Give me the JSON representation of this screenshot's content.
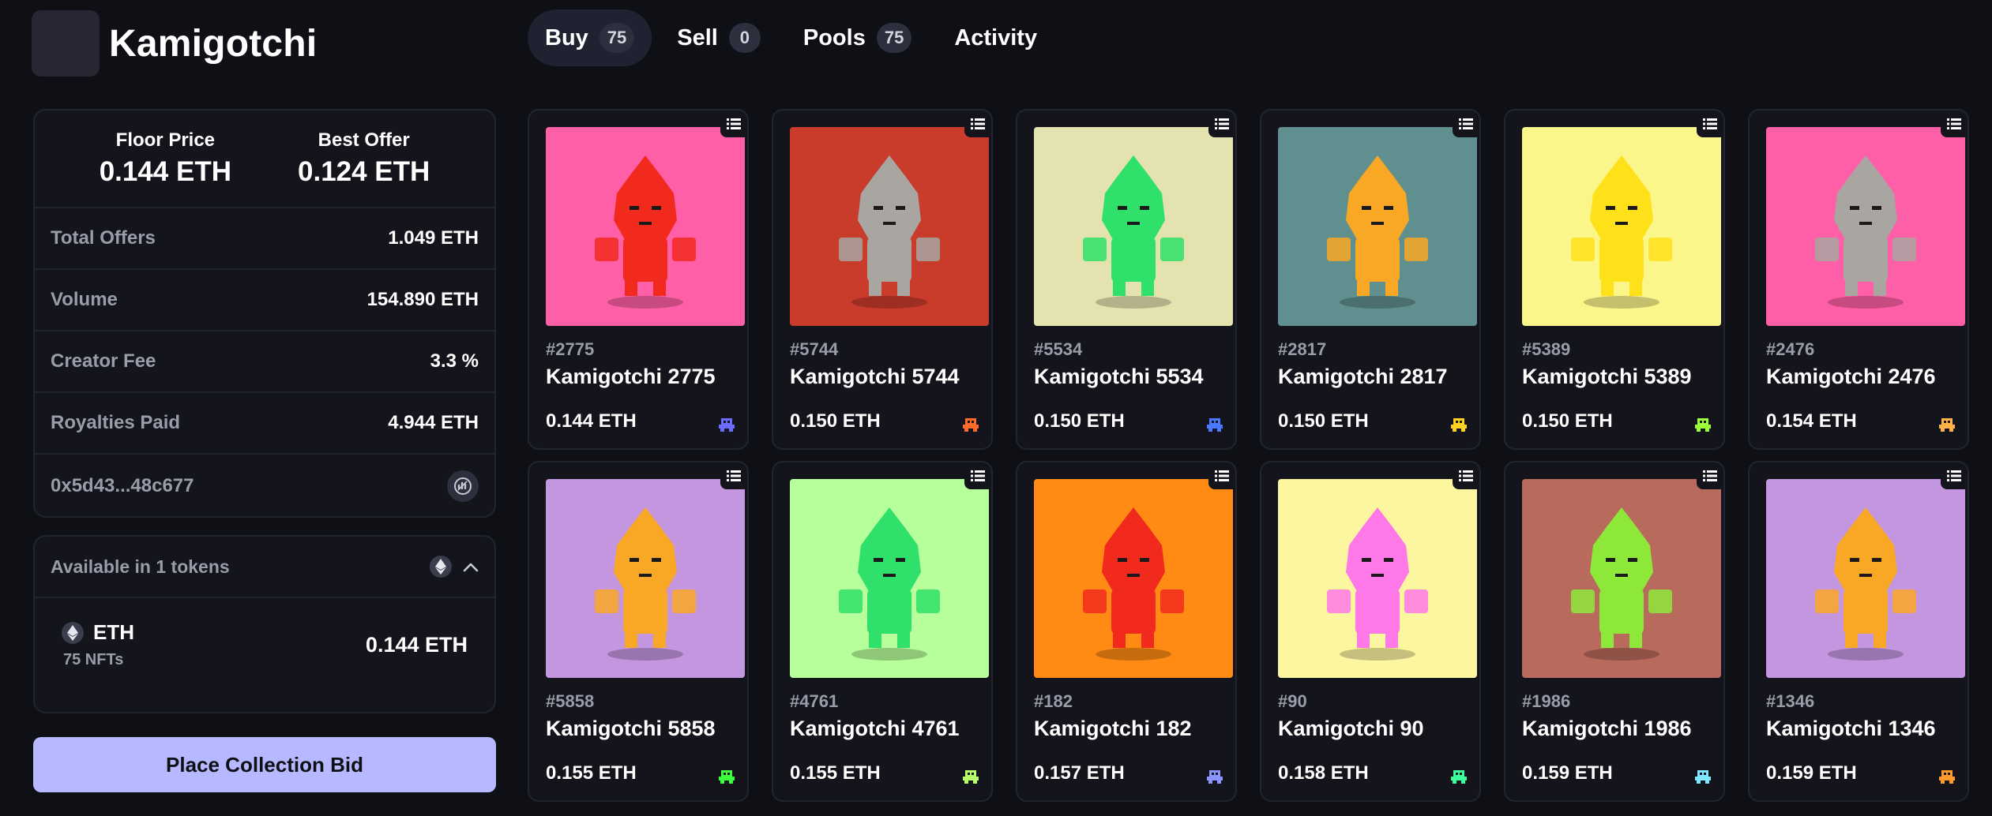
{
  "header": {
    "collection_name": "Kamigotchi",
    "tabs": [
      {
        "label": "Buy",
        "count": "75",
        "active": true
      },
      {
        "label": "Sell",
        "count": "0",
        "active": false
      },
      {
        "label": "Pools",
        "count": "75",
        "active": false
      },
      {
        "label": "Activity",
        "count": "",
        "active": false
      }
    ]
  },
  "stats": {
    "floor_price_label": "Floor Price",
    "floor_price_value": "0.144 ETH",
    "best_offer_label": "Best Offer",
    "best_offer_value": "0.124 ETH",
    "rows": [
      {
        "label": "Total Offers",
        "value": "1.049 ETH"
      },
      {
        "label": "Volume",
        "value": "154.890 ETH"
      },
      {
        "label": "Creator Fee",
        "value": "3.3 %"
      },
      {
        "label": "Royalties Paid",
        "value": "4.944 ETH"
      }
    ],
    "contract_address": "0x5d43...48c677"
  },
  "tokens": {
    "header_label": "Available in 1 tokens",
    "items": [
      {
        "symbol": "ETH",
        "nft_count": "75 NFTs",
        "price": "0.144 ETH"
      }
    ]
  },
  "bid_button_label": "Place Collection Bid",
  "colors": {
    "background": "#0f1015",
    "panel": "#14151c",
    "border": "#22242e",
    "accent_button": "#b6b9ff"
  },
  "items": [
    {
      "id": "#2775",
      "name": "Kamigotchi 2775",
      "price": "0.144 ETH",
      "bg": "#ff5fa6",
      "body": "#f22a1e",
      "trait_color": "#6b6bff",
      "icon": "kami-2775-icon"
    },
    {
      "id": "#5744",
      "name": "Kamigotchi 5744",
      "price": "0.150 ETH",
      "bg": "#c93c2b",
      "body": "#a9a6a2",
      "trait_color": "#ff6a2a",
      "icon": "kami-5744-icon"
    },
    {
      "id": "#5534",
      "name": "Kamigotchi 5534",
      "price": "0.150 ETH",
      "bg": "#e4e3b0",
      "body": "#2fe06a",
      "trait_color": "#4a78ff",
      "icon": "kami-5534-icon"
    },
    {
      "id": "#2817",
      "name": "Kamigotchi 2817",
      "price": "0.150 ETH",
      "bg": "#5f8f8e",
      "body": "#f9a825",
      "trait_color": "#ffd21f",
      "icon": "kami-2817-icon"
    },
    {
      "id": "#5389",
      "name": "Kamigotchi 5389",
      "price": "0.150 ETH",
      "bg": "#fbf68a",
      "body": "#ffe11a",
      "trait_color": "#9bff3a",
      "icon": "kami-5389-icon"
    },
    {
      "id": "#2476",
      "name": "Kamigotchi 2476",
      "price": "0.154 ETH",
      "bg": "#ff5fa6",
      "body": "#a9a6a2",
      "trait_color": "#ffb347",
      "icon": "kami-2476-icon"
    },
    {
      "id": "#5858",
      "name": "Kamigotchi 5858",
      "price": "0.155 ETH",
      "bg": "#c596e0",
      "body": "#f9a825",
      "trait_color": "#3aff3a",
      "icon": "kami-5858-icon"
    },
    {
      "id": "#4761",
      "name": "Kamigotchi 4761",
      "price": "0.155 ETH",
      "bg": "#b7ff9a",
      "body": "#2fe06a",
      "trait_color": "#b6ff6a",
      "icon": "kami-4761-icon"
    },
    {
      "id": "#182",
      "name": "Kamigotchi 182",
      "price": "0.157 ETH",
      "bg": "#ff8a14",
      "body": "#f22a1e",
      "trait_color": "#8a93ff",
      "icon": "kami-182-icon"
    },
    {
      "id": "#90",
      "name": "Kamigotchi 90",
      "price": "0.158 ETH",
      "bg": "#fdf6a0",
      "body": "#ff78e8",
      "trait_color": "#3aff9a",
      "icon": "kami-90-icon"
    },
    {
      "id": "#1986",
      "name": "Kamigotchi 1986",
      "price": "0.159 ETH",
      "bg": "#b86a5c",
      "body": "#8ee83a",
      "trait_color": "#7fe6ff",
      "icon": "kami-1986-icon"
    },
    {
      "id": "#1346",
      "name": "Kamigotchi 1346",
      "price": "0.159 ETH",
      "bg": "#c596e0",
      "body": "#f9a825",
      "trait_color": "#ff9a2a",
      "icon": "kami-1346-icon"
    }
  ]
}
